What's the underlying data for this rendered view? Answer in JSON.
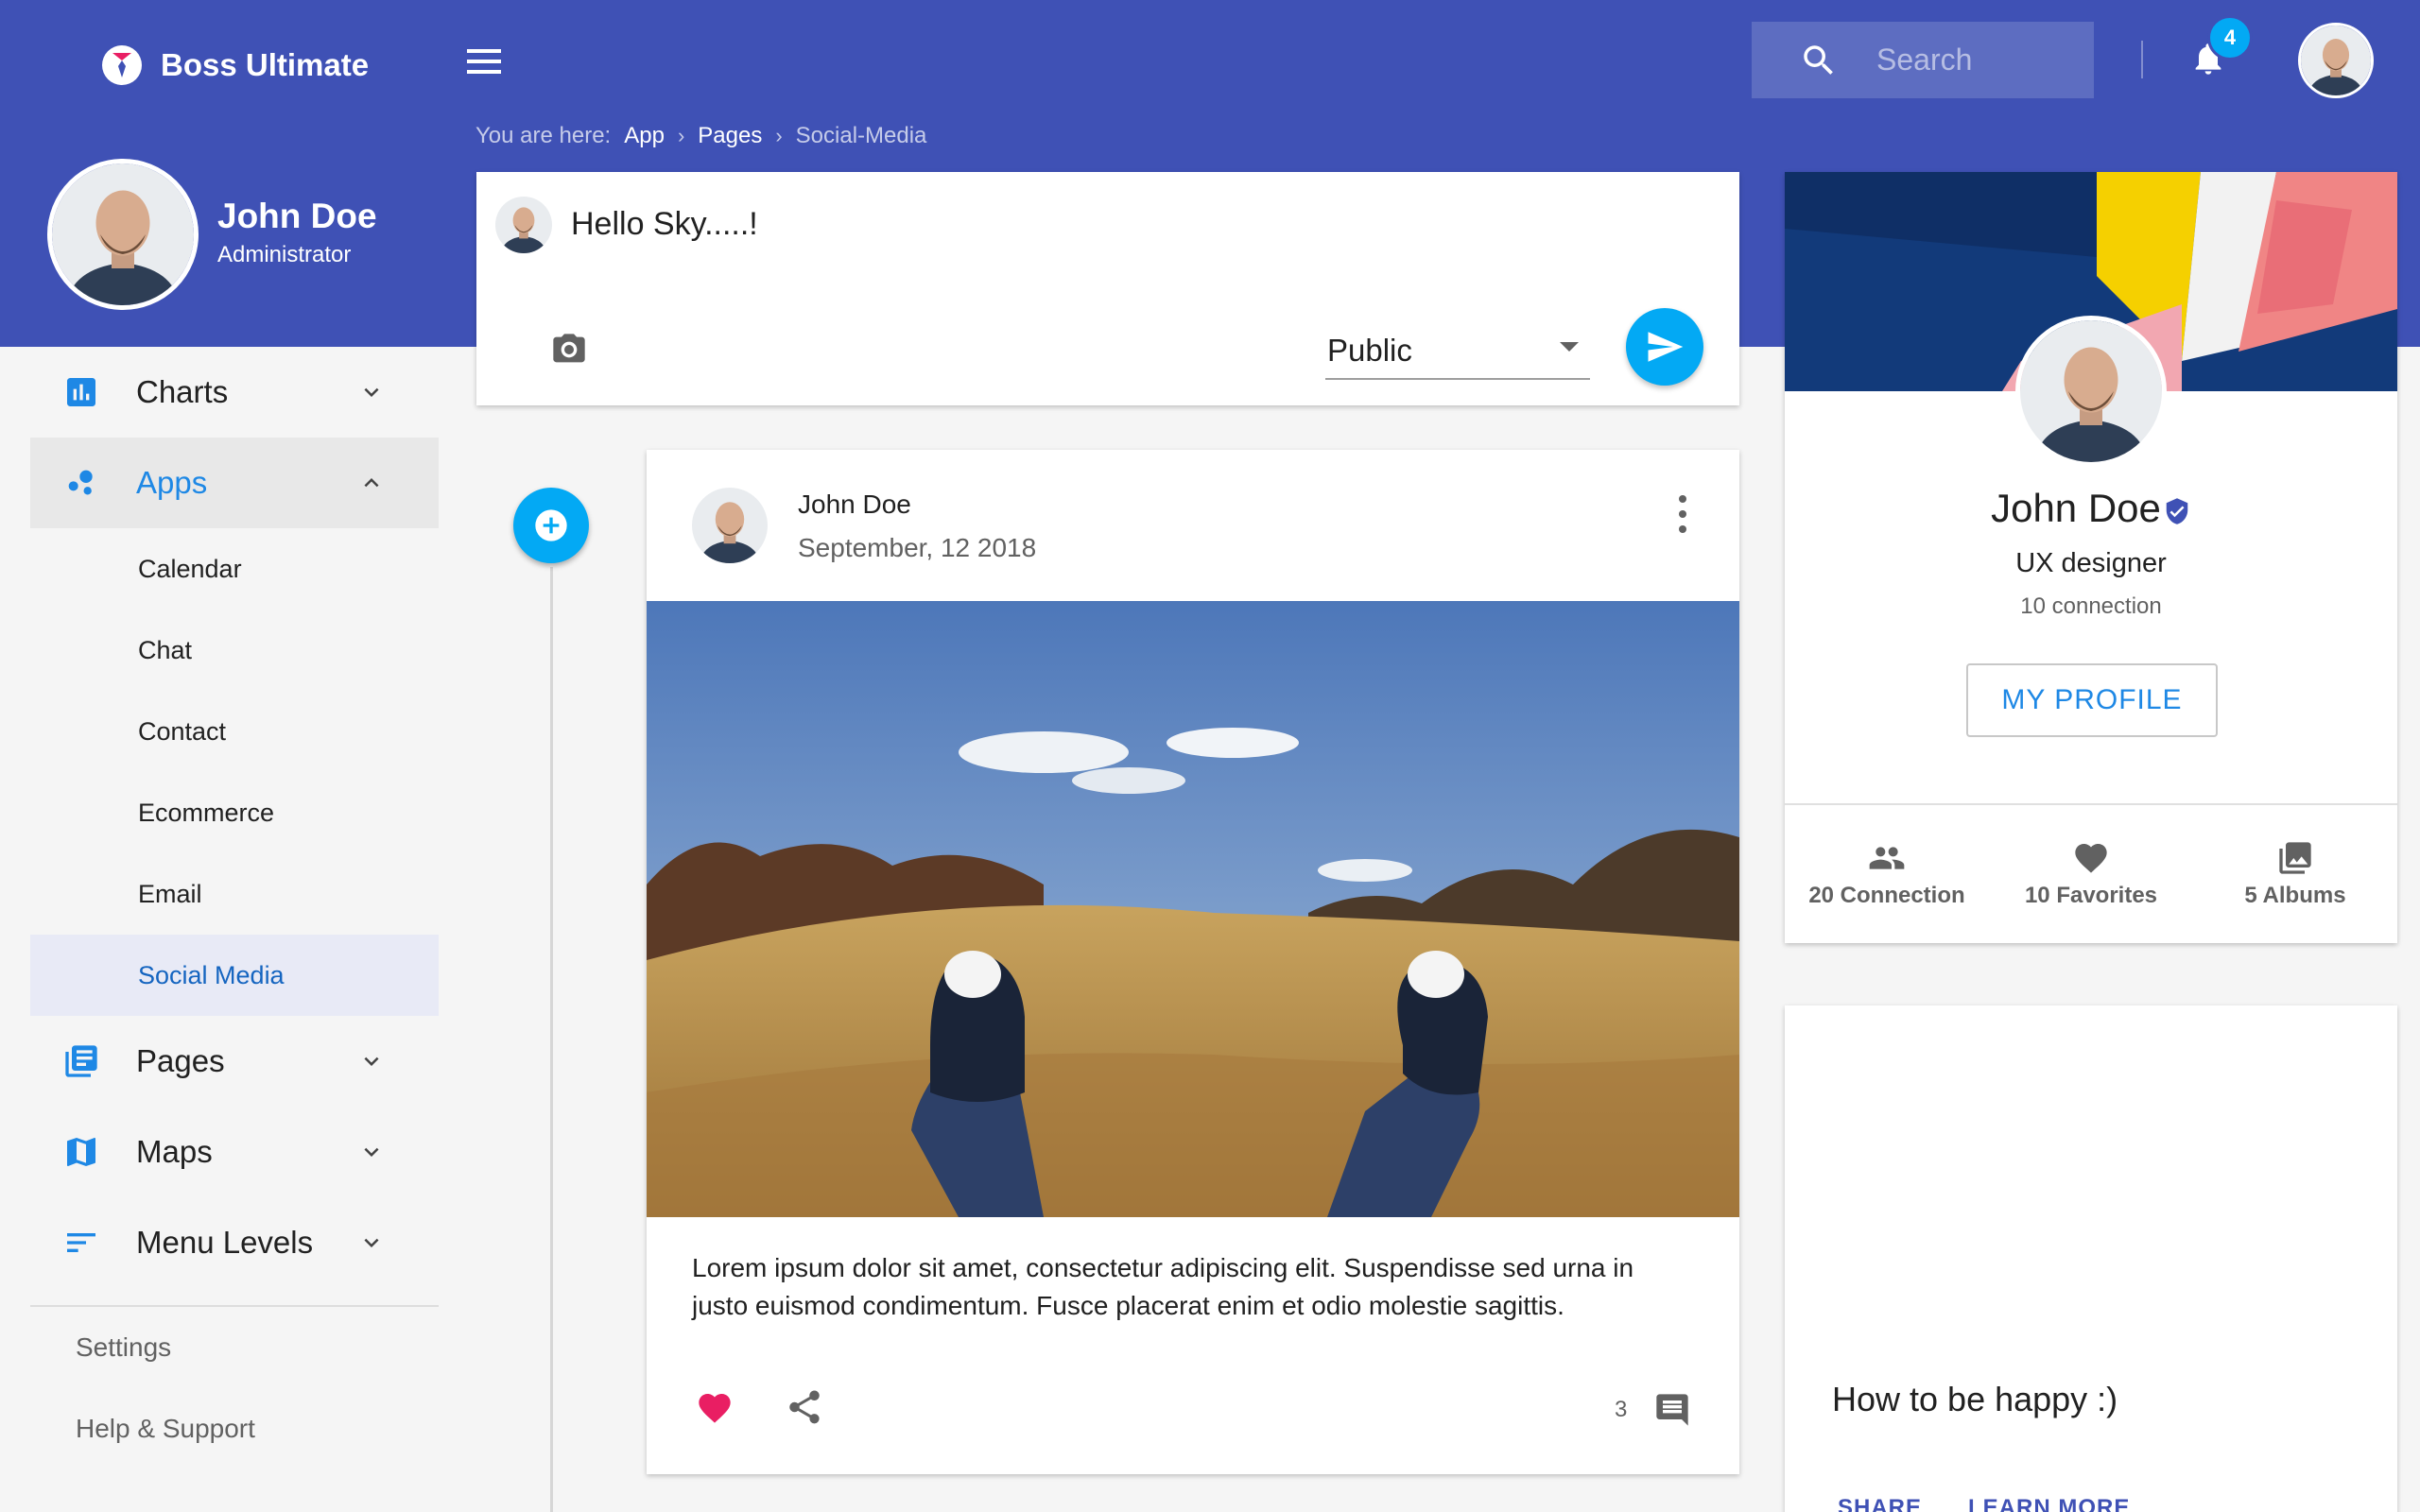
{
  "app": {
    "name": "Boss Ultimate"
  },
  "header": {
    "search_placeholder": "Search",
    "notification_count": "4"
  },
  "user": {
    "name": "John Doe",
    "role": "Administrator"
  },
  "sidebar": {
    "items": [
      {
        "label": "Charts"
      },
      {
        "label": "Apps"
      },
      {
        "label": "Pages"
      },
      {
        "label": "Maps"
      },
      {
        "label": "Menu Levels"
      }
    ],
    "apps_sub": [
      {
        "label": "Calendar"
      },
      {
        "label": "Chat"
      },
      {
        "label": "Contact"
      },
      {
        "label": "Ecommerce"
      },
      {
        "label": "Email"
      },
      {
        "label": "Social Media"
      }
    ],
    "footer": [
      {
        "label": "Settings"
      },
      {
        "label": "Help & Support"
      }
    ]
  },
  "breadcrumb": {
    "prefix": "You are here:",
    "items": [
      "App",
      "Pages"
    ],
    "current": "Social-Media"
  },
  "composer": {
    "text": "Hello Sky.....!",
    "privacy": "Public"
  },
  "post": {
    "author": "John Doe",
    "date": "September, 12 2018",
    "text": "Lorem ipsum dolor sit amet, consectetur adipiscing elit. Suspendisse sed urna in justo euismod condimentum. Fusce placerat enim et odio molestie sagittis.",
    "comment_count": "3"
  },
  "profile": {
    "name": "John Doe",
    "title": "UX designer",
    "connections": "10 connection",
    "button": "MY PROFILE",
    "stats": [
      {
        "label": "20 Connection"
      },
      {
        "label": "10 Favorites"
      },
      {
        "label": "5 Albums"
      }
    ]
  },
  "howto": {
    "title": "How to be happy :)",
    "actions": [
      "SHARE",
      "LEARN MORE"
    ]
  },
  "colors": {
    "primary": "#3f51b5",
    "accent": "#03a9f4",
    "like": "#e91e63",
    "link": "#1e88e5"
  }
}
